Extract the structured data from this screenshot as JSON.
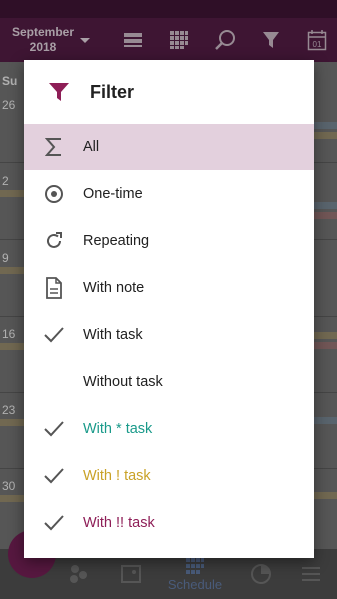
{
  "app_bar": {
    "month_line1": "September",
    "month_line2": "2018",
    "icons": [
      "week-view-icon",
      "month-view-icon",
      "search-icon",
      "filter-icon",
      "today-icon"
    ]
  },
  "calendar": {
    "day_of_week_first": "Su",
    "first_column_days": [
      "26",
      "2",
      "9",
      "16",
      "23",
      "30"
    ]
  },
  "bottom_nav": {
    "items": [
      {
        "icon": "events-icon",
        "label": ""
      },
      {
        "icon": "photos-icon",
        "label": ""
      },
      {
        "icon": "schedule-icon",
        "label": "Schedule"
      },
      {
        "icon": "stats-icon",
        "label": ""
      },
      {
        "icon": "settings-icon",
        "label": ""
      }
    ]
  },
  "filter_dialog": {
    "title": "Filter",
    "options": [
      {
        "label": "All",
        "icon": "sigma-icon",
        "selected": true,
        "color": "#212121"
      },
      {
        "label": "One-time",
        "icon": "radio-dot-icon",
        "selected": false,
        "color": "#212121"
      },
      {
        "label": "Repeating",
        "icon": "refresh-icon",
        "selected": false,
        "color": "#212121"
      },
      {
        "label": "With note",
        "icon": "note-icon",
        "selected": false,
        "color": "#212121"
      },
      {
        "label": "With task",
        "icon": "check-icon",
        "selected": false,
        "color": "#212121"
      },
      {
        "label": "Without task",
        "icon": "",
        "selected": false,
        "color": "#212121"
      },
      {
        "label": "With * task",
        "icon": "check-icon",
        "selected": false,
        "color": "#1a9a8a"
      },
      {
        "label": "With ! task",
        "icon": "check-icon",
        "selected": false,
        "color": "#c9a227"
      },
      {
        "label": "With !! task",
        "icon": "check-icon",
        "selected": false,
        "color": "#8e1e57"
      }
    ]
  },
  "colors": {
    "accent": "#8e1e57",
    "selected_row": "#e3d0dd",
    "app_bar": "#4c1a3f"
  }
}
